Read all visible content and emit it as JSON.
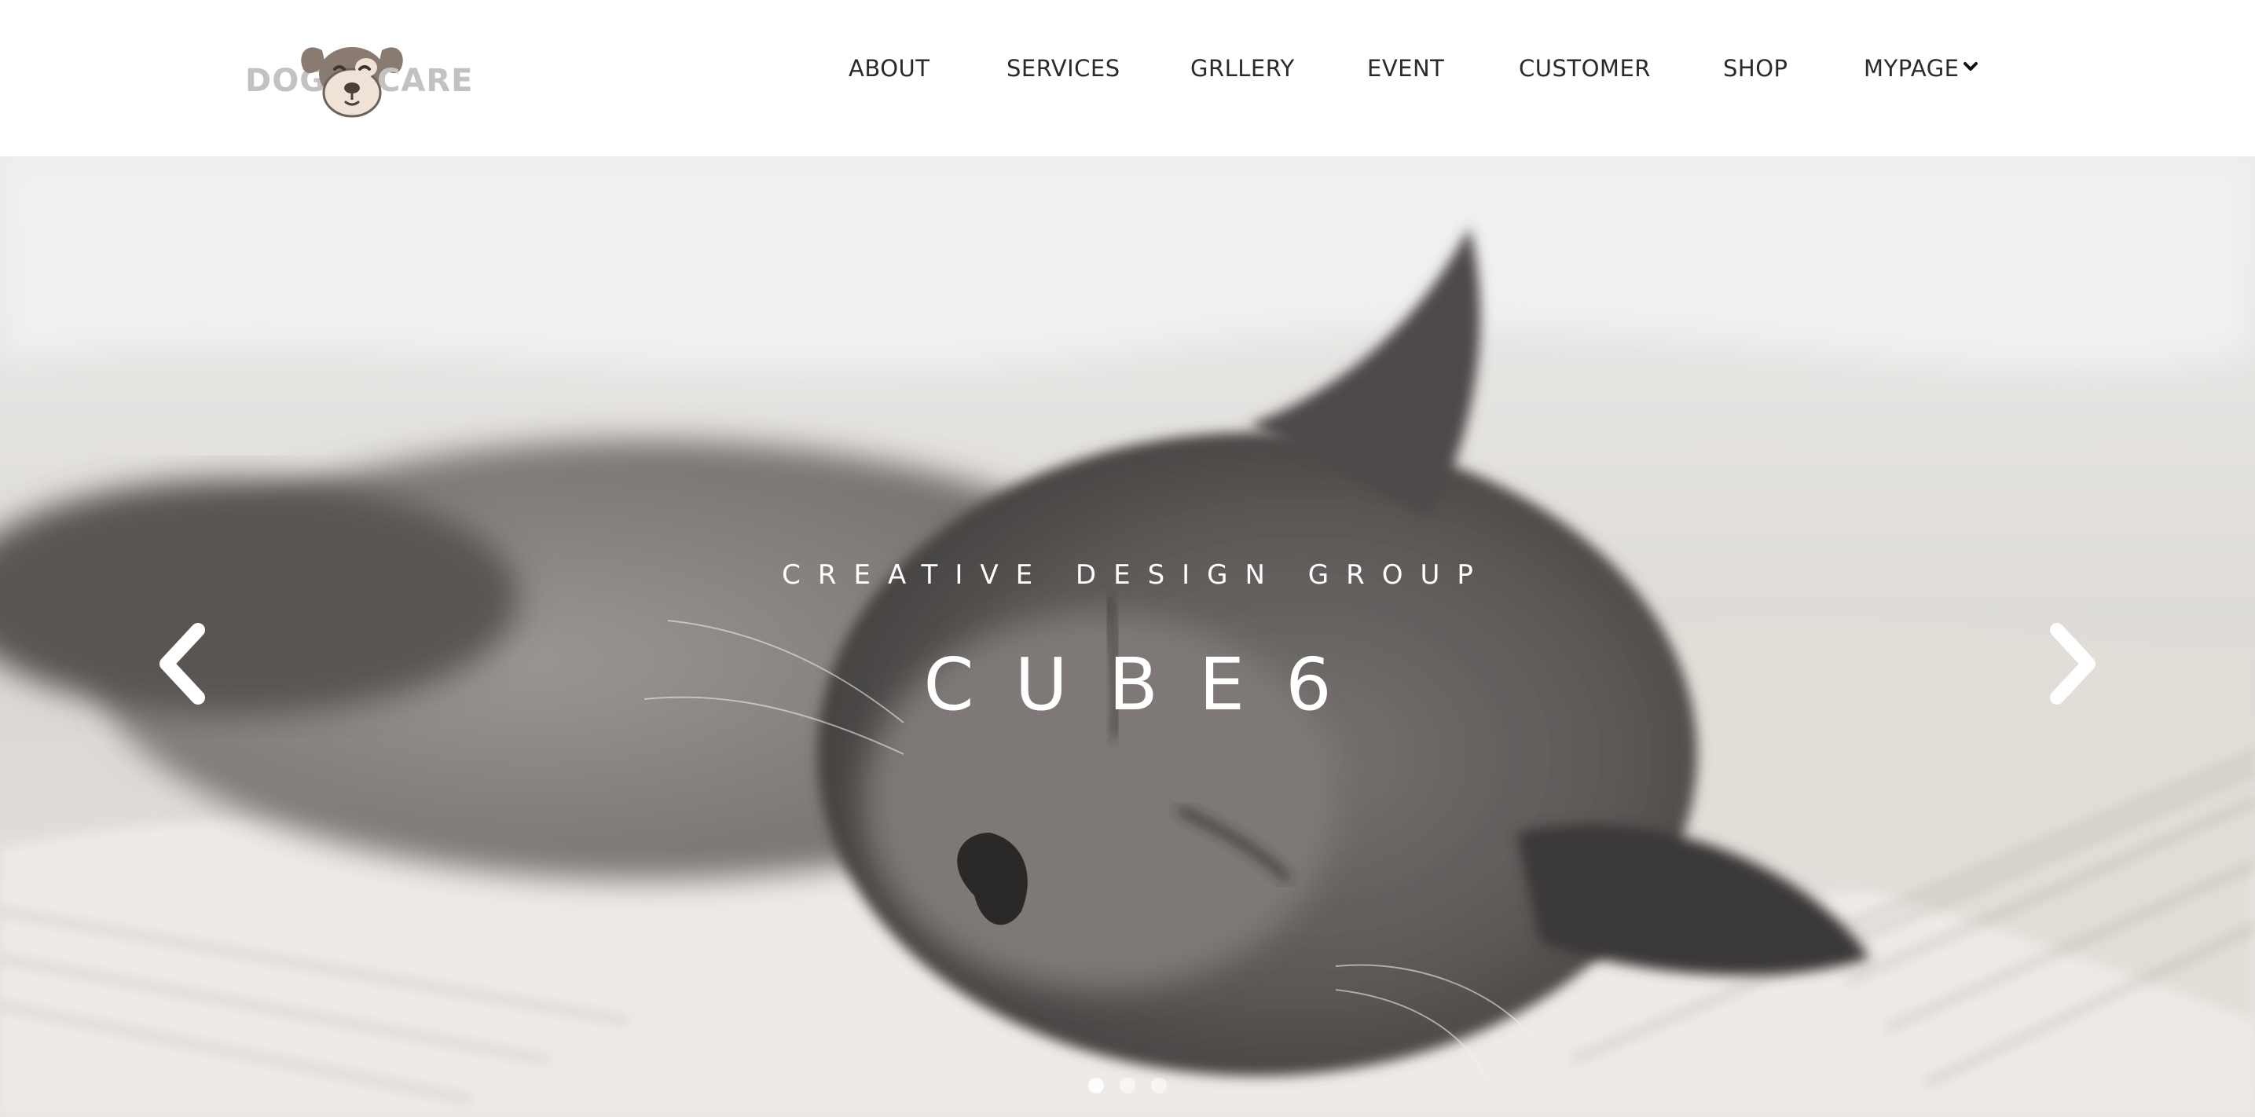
{
  "brand": {
    "logo_left_word": "DOG",
    "logo_right_word": "CARE",
    "logo_icon": "dog-face-icon",
    "logo_color": "#c2c2c2",
    "dog_fur_color": "#8a7b72",
    "dog_face_color": "#efe2d6"
  },
  "nav": {
    "items": [
      {
        "label": "ABOUT"
      },
      {
        "label": "SERVICES"
      },
      {
        "label": "GRLLERY"
      },
      {
        "label": "EVENT"
      },
      {
        "label": "CUSTOMER"
      },
      {
        "label": "SHOP"
      },
      {
        "label": "MYPAGE",
        "icon": "chevron-down-icon"
      }
    ]
  },
  "hero": {
    "subtitle": "CREATIVE DESIGN GROUP",
    "title": "CUBE6",
    "prev_icon": "chevron-left-icon",
    "next_icon": "chevron-right-icon",
    "slides_total": 3,
    "active_slide": 1,
    "text_color": "#ffffff"
  }
}
